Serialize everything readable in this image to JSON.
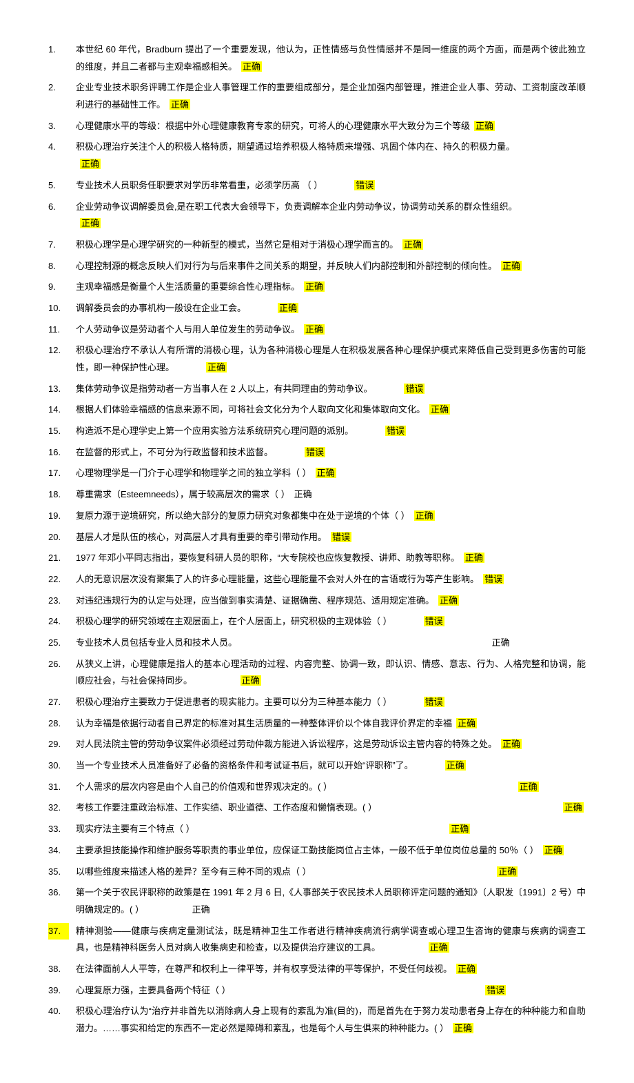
{
  "items": [
    {
      "num": 1,
      "text": "本世纪 60 年代，Bradburn 提出了一个重要发现，他认为，正性情感与负性情感并不是同一维度的两个方面，而是两个彼此独立的维度，并且二者都与主观幸福感相关。",
      "answer": "正确",
      "hl": true,
      "numhl": false
    },
    {
      "num": 2,
      "text": "企业专业技术职务评聘工作是企业人事管理工作的重要组成部分，是企业加强内部管理，推进企业人事、劳动、工资制度改革顺利进行的基础性工作。",
      "answer": "正确",
      "hl": true,
      "numhl": false
    },
    {
      "num": 3,
      "text": "心理健康水平的等级：根据中外心理健康教育专家的研究，可将人的心理健康水平大致分为三个等级",
      "answer": "正确",
      "hl": true,
      "numhl": false
    },
    {
      "num": 4,
      "text": "积极心理治疗关注个人的积极人格特质，期望通过培养积极人格特质来增强、巩固个体内在、持久的积极力量。",
      "answer": "正确",
      "hl": true,
      "numhl": false,
      "break": true
    },
    {
      "num": 5,
      "text": "专业技术人员职务任职要求对学历非常看重，必须学历高 （ ）",
      "answer": "错误",
      "hl": true,
      "numhl": false,
      "gap": true
    },
    {
      "num": 6,
      "text": "企业劳动争议调解委员会,是在职工代表大会领导下，负责调解本企业内劳动争议，协调劳动关系的群众性组织。",
      "answer": "正确",
      "hl": true,
      "numhl": false,
      "break": true
    },
    {
      "num": 7,
      "text": "积极心理学是心理学研究的一种新型的模式，当然它是相对于消极心理学而言的。",
      "answer": "正确",
      "hl": true,
      "numhl": false
    },
    {
      "num": 8,
      "text": "心理控制源的概念反映人们对行为与后来事件之间关系的期望，并反映人们内部控制和外部控制的倾向性。",
      "answer": "正确",
      "hl": true,
      "numhl": false
    },
    {
      "num": 9,
      "text": "主观幸福感是衡量个人生活质量的重要综合性心理指标。",
      "answer": "正确",
      "hl": true,
      "numhl": false
    },
    {
      "num": 10,
      "text": "调解委员会的办事机构一般设在企业工会。",
      "answer": "正确",
      "hl": true,
      "numhl": false,
      "gap": true
    },
    {
      "num": 11,
      "text": "个人劳动争议是劳动者个人与用人单位发生的劳动争议。",
      "answer": "正确",
      "hl": true,
      "numhl": false
    },
    {
      "num": 12,
      "text": "积极心理治疗不承认人有所谓的消极心理，认为各种消极心理是人在积极发展各种心理保护模式来降低自己受到更多伤害的可能性，即一种保护性心理。",
      "answer": "正确",
      "hl": true,
      "numhl": false,
      "gap": true
    },
    {
      "num": 13,
      "text": "集体劳动争议是指劳动者一方当事人在 2 人以上，有共同理由的劳动争议。",
      "answer": "错误",
      "hl": true,
      "numhl": false,
      "gap": true
    },
    {
      "num": 14,
      "text": "根据人们体验幸福感的信息来源不同，可将社会文化分为个人取向文化和集体取向文化。",
      "answer": "正确",
      "hl": true,
      "numhl": false
    },
    {
      "num": 15,
      "text": "构造派不是心理学史上第一个应用实验方法系统研究心理问题的派别。",
      "answer": "错误",
      "hl": true,
      "numhl": false,
      "gap": true
    },
    {
      "num": 16,
      "text": "在监督的形式上，不可分为行政监督和技术监督。",
      "answer": "错误",
      "hl": true,
      "numhl": false,
      "gap": true
    },
    {
      "num": 17,
      "text": "心理物理学是一门介于心理学和物理学之间的独立学科（ ）",
      "answer": "正确",
      "hl": true,
      "numhl": false
    },
    {
      "num": 18,
      "text": "尊重需求（Esteemneeds），属于较高层次的需求（ ）",
      "answer": "正确",
      "hl": false,
      "numhl": false
    },
    {
      "num": 19,
      "text": "复原力源于逆境研究，所以绝大部分的复原力研究对象都集中在处于逆境的个体（ ）",
      "answer": "正确",
      "hl": true,
      "numhl": false
    },
    {
      "num": 20,
      "text": "基层人才是队伍的核心，对高层人才具有重要的牵引带动作用。",
      "answer": "错误",
      "hl": true,
      "numhl": false
    },
    {
      "num": 21,
      "text": "1977 年邓小平同志指出，要恢复科研人员的职称，“大专院校也应恢复教授、讲师、助教等职称。",
      "answer": "正确",
      "hl": true,
      "numhl": false
    },
    {
      "num": 22,
      "text": "人的无意识层次没有聚集了人的许多心理能量，这些心理能量不会对人外在的言语或行为等产生影响。",
      "answer": "错误",
      "hl": true,
      "numhl": false
    },
    {
      "num": 23,
      "text": "对违纪违规行为的认定与处理，应当做到事实清楚、证据确凿、程序规范、适用规定准确。",
      "answer": "正确",
      "hl": true,
      "numhl": false
    },
    {
      "num": 24,
      "text": "积极心理学的研究领域在主观层面上，在个人层面上，研究积极的主观体验（ ）",
      "answer": "错误",
      "hl": true,
      "numhl": false,
      "gap": true
    },
    {
      "num": 25,
      "text": "专业技术人员包括专业人员和技术人员。",
      "answer": "正确",
      "hl": false,
      "numhl": false,
      "far": true
    },
    {
      "num": 26,
      "text": "从狭义上讲，心理健康是指人的基本心理活动的过程、内容完整、协调一致，即认识、情感、意志、行为、人格完整和协调，能顺应社会，与社会保持同步。",
      "answer": "正确",
      "hl": true,
      "numhl": false,
      "far": true
    },
    {
      "num": 27,
      "text": "积极心理治疗主要致力于促进患者的现实能力。主要可以分为三种基本能力（ ）",
      "answer": "错误",
      "hl": true,
      "numhl": false,
      "gap": true
    },
    {
      "num": 28,
      "text": "认为幸福是依据行动者自己界定的标准对其生活质量的一种整体评价以个体自我评价界定的幸福",
      "answer": "正确",
      "hl": true,
      "numhl": false
    },
    {
      "num": 29,
      "text": "对人民法院主管的劳动争议案件必须经过劳动仲裁方能进入诉讼程序，这是劳动诉讼主管内容的特殊之处。",
      "answer": "正确",
      "hl": true,
      "numhl": false
    },
    {
      "num": 30,
      "text": "当一个专业技术人员准备好了必备的资格条件和考试证书后，就可以开始“评职称”了。",
      "answer": "正确",
      "hl": true,
      "numhl": false,
      "gap": true
    },
    {
      "num": 31,
      "text": "个人需求的层次内容是由个人自己的价值观和世界观决定的。( ）",
      "answer": "正确",
      "hl": true,
      "numhl": false,
      "far": true
    },
    {
      "num": 32,
      "text": "考核工作要注重政治标准、工作实绩、职业道德、工作态度和懒惰表现。( ）",
      "answer": "正确",
      "hl": true,
      "numhl": false,
      "far": true
    },
    {
      "num": 33,
      "text": "现实疗法主要有三个特点（ ）",
      "answer": "正确",
      "hl": true,
      "numhl": false,
      "far": true
    },
    {
      "num": 34,
      "text": "主要承担技能操作和维护服务等职责的事业单位，应保证工勤技能岗位占主体，一般不低于单位岗位总量的 50％（ ）",
      "answer": "正确",
      "hl": true,
      "numhl": false
    },
    {
      "num": 35,
      "text": "以哪些维度来描述人格的差异？至今有三种不同的观点（ ）",
      "answer": "正确",
      "hl": true,
      "numhl": false,
      "far": true
    },
    {
      "num": 36,
      "text": "第一个关于农民评职称的政策是在 1991 年 2 月 6 日,《人事部关于农民技术人员职称评定问题的通知》（人职发〔1991〕2 号）中明确规定的。( ）",
      "answer": "正确",
      "hl": false,
      "numhl": false,
      "far": true
    },
    {
      "num": 37,
      "text": "精神测验——健康与疾病定量测试法，既是精神卫生工作者进行精神疾病流行病学调查或心理卫生咨询的健康与疾病的调查工具，也是精神科医务人员对病人收集病史和检查，以及提供治疗建议的工具。",
      "answer": "正确",
      "hl": true,
      "numhl": true,
      "far": true
    },
    {
      "num": 38,
      "text": "在法律面前人人平等，在尊严和权利上一律平等，并有权享受法律的平等保护，不受任何歧视。",
      "answer": "正确",
      "hl": true,
      "numhl": false
    },
    {
      "num": 39,
      "text": "心理复原力强，主要具备两个特征（ ）",
      "answer": "错误",
      "hl": true,
      "numhl": false,
      "far": true
    },
    {
      "num": 40,
      "text": "积极心理治疗认为“治疗并非首先以消除病人身上现有的紊乱为准(目的)，而是首先在于努力发动患者身上存在的种种能力和自助潜力。……事实和给定的东西不一定必然是障碍和紊乱，也是每个人与生俱来的种种能力。( ）",
      "answer": "正确",
      "hl": true,
      "numhl": false
    }
  ]
}
